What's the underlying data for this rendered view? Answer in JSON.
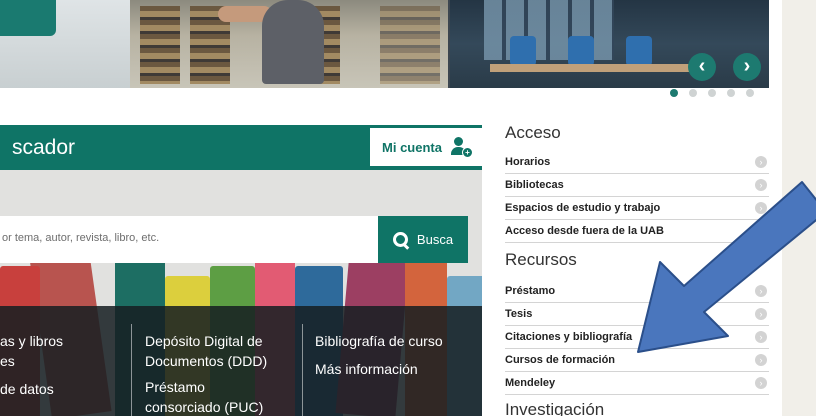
{
  "carousel": {
    "prev_icon": "chevron-left-icon",
    "next_icon": "chevron-right-icon",
    "prev_glyph": "‹",
    "next_glyph": "›",
    "slide_count": 5,
    "active_slide": 1
  },
  "buscador": {
    "title": "scador",
    "account_label": "Mi cuenta",
    "search_placeholder": "or tema, autor, revista, libro, etc.",
    "search_button": "Busca"
  },
  "links": {
    "col1": [
      "as y libros",
      "es",
      "de datos"
    ],
    "col2": [
      "Depósito Digital de",
      "Documentos (DDD)",
      "Préstamo",
      "consorciado (PUC)"
    ],
    "col3": [
      "Bibliografía de curso",
      "Más información"
    ]
  },
  "right_menu": {
    "acceso": {
      "title": "Acceso",
      "items": [
        "Horarios",
        "Bibliotecas",
        "Espacios de estudio y trabajo",
        "Acceso desde fuera de la UAB"
      ]
    },
    "recursos": {
      "title": "Recursos",
      "items": [
        "Préstamo",
        "Tesis",
        "Citaciones y bibliografía",
        "Cursos de formación",
        "Mendeley"
      ]
    },
    "investigacion": {
      "title": "Investigación"
    }
  },
  "colors": {
    "brand": "#0f7466",
    "annotation_arrow": "#4a76bd"
  }
}
